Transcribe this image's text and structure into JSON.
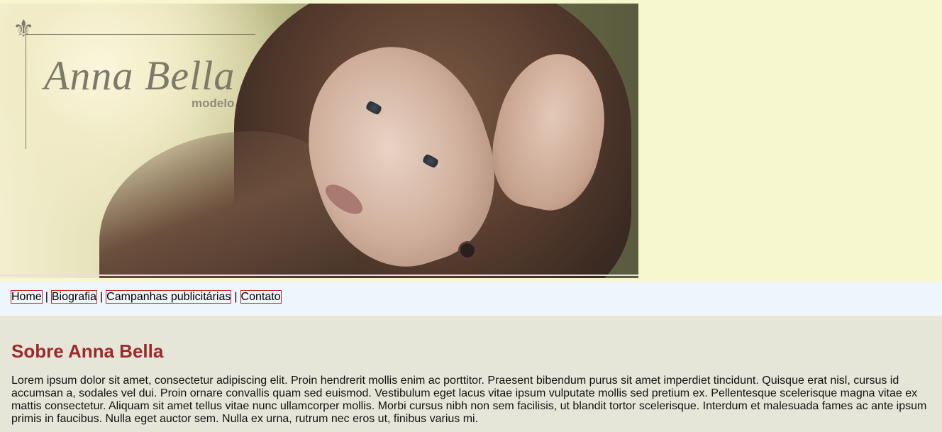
{
  "logo": {
    "symbol": "⚜",
    "name": "Anna Bella",
    "subtitle": "modelo"
  },
  "nav": {
    "items": [
      {
        "label": "Home"
      },
      {
        "label": "Biografia"
      },
      {
        "label": "Campanhas publicitárias"
      },
      {
        "label": "Contato"
      }
    ],
    "separator": "|"
  },
  "main": {
    "heading": "Sobre Anna Bella",
    "paragraph": "Lorem ipsum dolor sit amet, consectetur adipiscing elit. Proin hendrerit mollis enim ac porttitor. Praesent bibendum purus sit amet imperdiet tincidunt. Quisque erat nisl, cursus id accumsan a, sodales vel dui. Proin ornare convallis quam sed euismod. Vestibulum eget lacus vitae ipsum vulputate mollis sed pretium ex. Pellentesque scelerisque magna vitae ex mattis consectetur. Aliquam sit amet tellus vitae nunc ullamcorper mollis. Morbi cursus nibh non sem facilisis, ut blandit tortor scelerisque. Interdum et malesuada fames ac ante ipsum primis in faucibus. Nulla eget auctor sem. Nulla ex urna, rutrum nec eros ut, finibus varius mi."
  },
  "colors": {
    "page_background": "#f7f7cf",
    "nav_background": "#eef5fb",
    "nav_link_border": "#c7272b",
    "main_background": "#e6e6d8",
    "heading": "#9c2a2c",
    "logo": "#7c7a68"
  }
}
